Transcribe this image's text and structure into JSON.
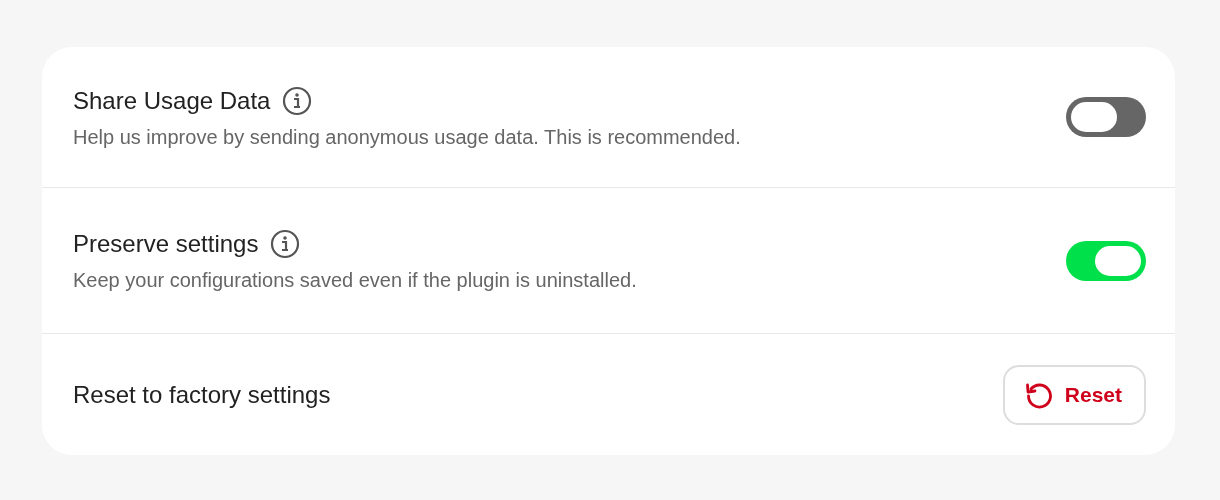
{
  "settings": [
    {
      "kind": "toggle",
      "title": "Share Usage Data",
      "info": true,
      "description": "Help us improve by sending anonymous usage data. This is recommended.",
      "on": false
    },
    {
      "kind": "toggle",
      "title": "Preserve settings",
      "info": true,
      "description": "Keep your configurations saved even if the plugin is uninstalled.",
      "on": true
    },
    {
      "kind": "button",
      "title": "Reset to factory settings",
      "button": "Reset"
    }
  ]
}
